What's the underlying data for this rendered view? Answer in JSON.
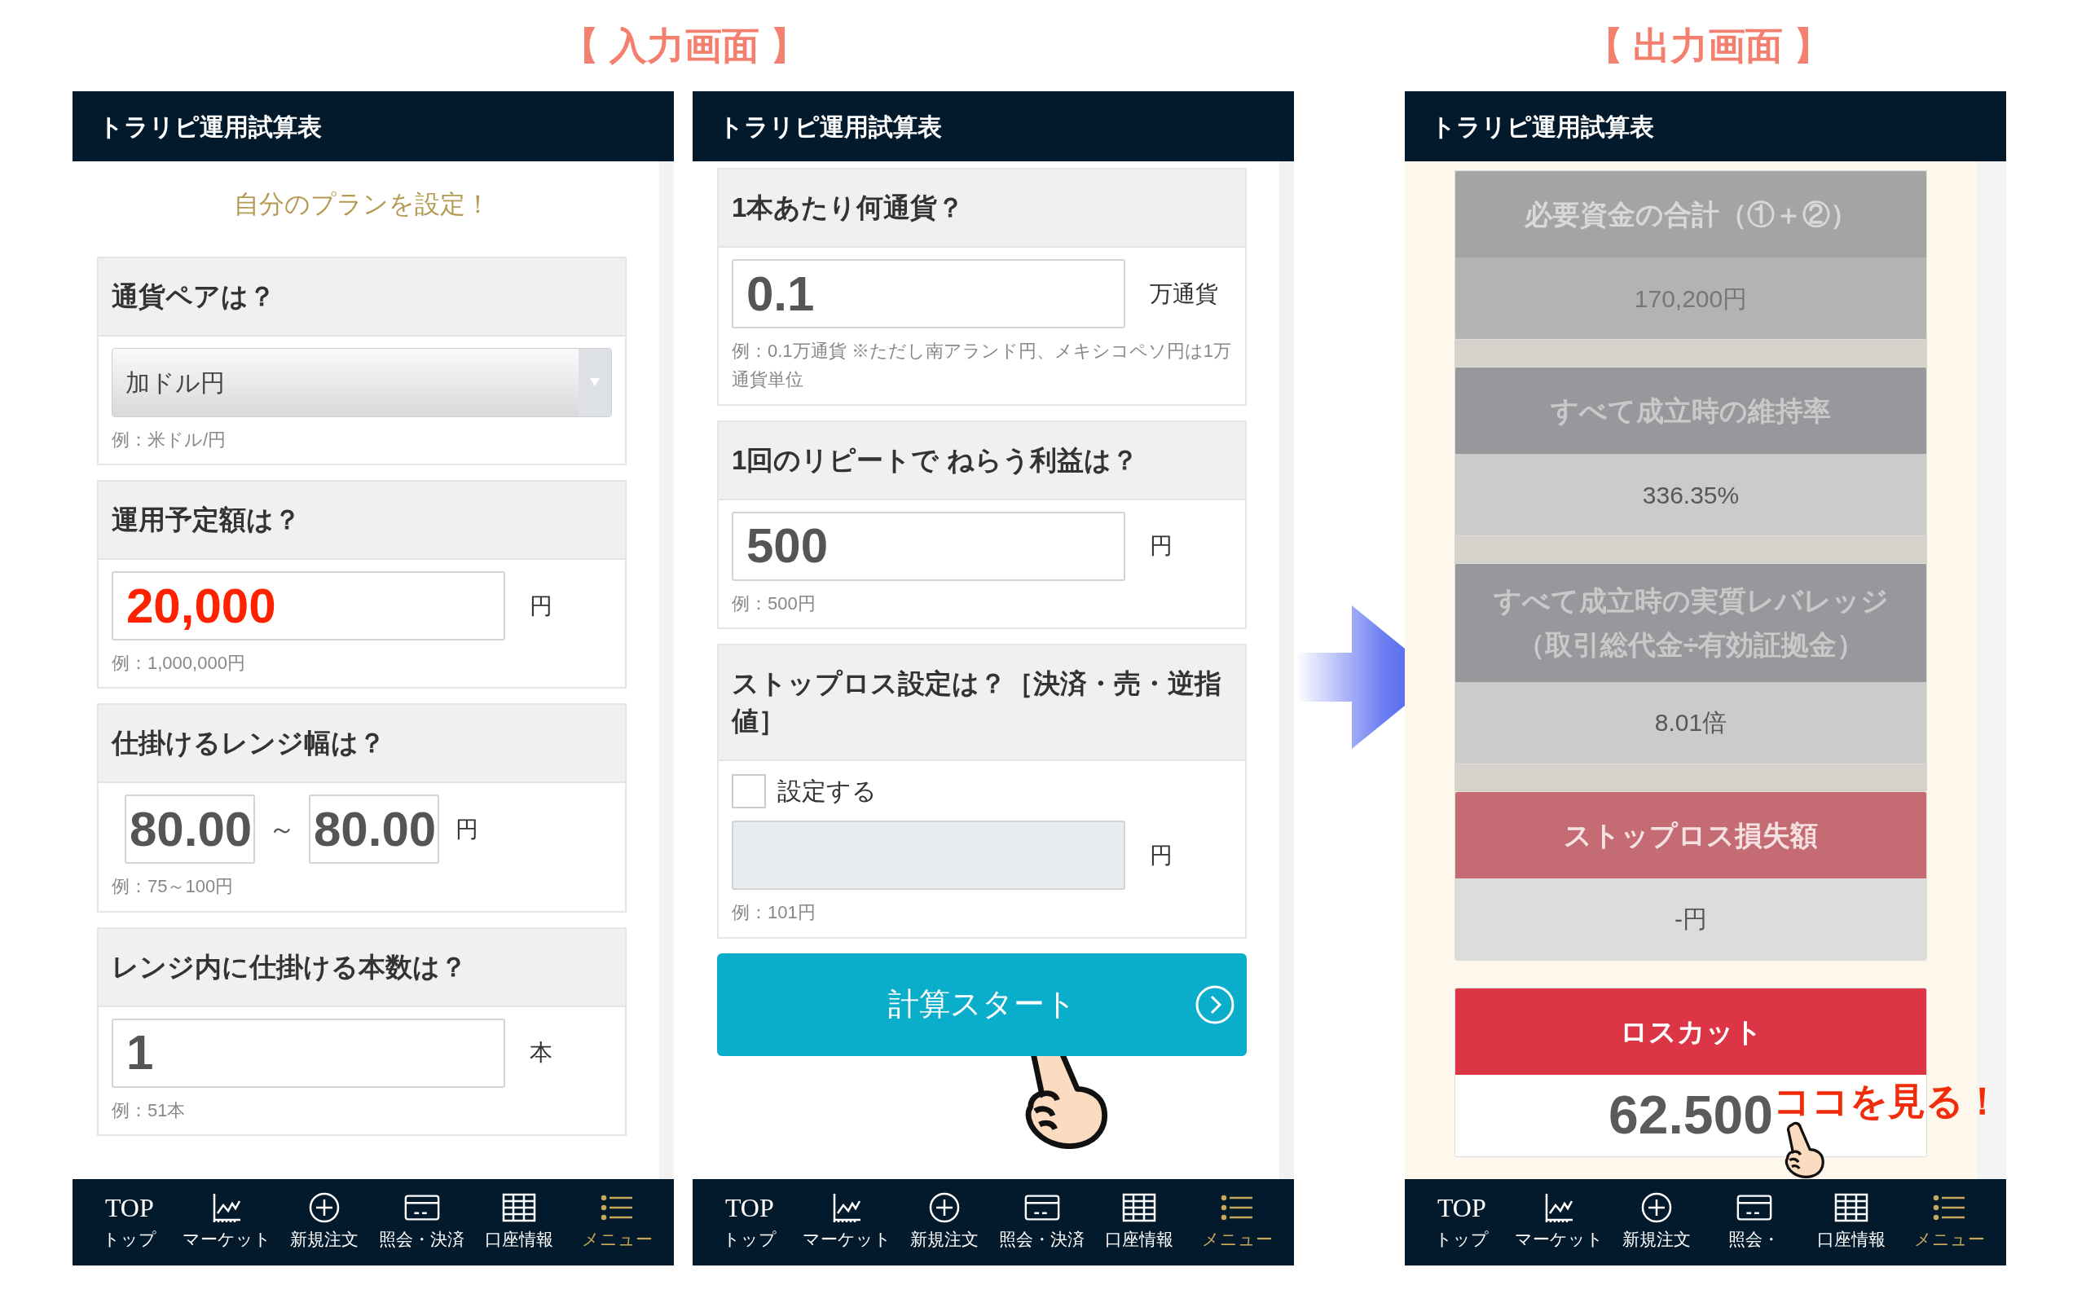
{
  "captions": [
    {
      "text": "【 入力画面 】"
    },
    {
      "text": "【 出力画面 】"
    }
  ],
  "screens": [
    {
      "kind": "input",
      "title": "トラリピ運用試算表",
      "intro": "自分のプランを設定！",
      "sections": [
        {
          "kind": "select",
          "heading": "通貨ペアは？",
          "value": "加ドル円",
          "hint": "例：米ドル/円"
        },
        {
          "kind": "input",
          "heading": "運用予定額は？",
          "value": "20,000",
          "highlighted": true,
          "unit": "円",
          "hint": "例：1,000,000円"
        },
        {
          "kind": "range",
          "heading": "仕掛けるレンジ幅は？",
          "values": [
            "80.00",
            "80.00"
          ],
          "separator": "～",
          "unit": "円",
          "hint": "例：75～100円"
        },
        {
          "kind": "input",
          "heading": "レンジ内に仕掛ける本数は？",
          "value": "1",
          "highlighted": false,
          "unit": "本",
          "hint": "例：51本"
        }
      ],
      "nav": [
        {
          "mark": "TOP",
          "label": "トップ",
          "selected": false
        },
        {
          "label": "マーケット",
          "selected": false
        },
        {
          "label": "新規注文",
          "selected": false
        },
        {
          "label": "照会・決済",
          "selected": false
        },
        {
          "label": "口座情報",
          "selected": false
        },
        {
          "label": "メニュー",
          "selected": true
        }
      ]
    },
    {
      "kind": "input",
      "title": "トラリピ運用試算表",
      "sections": [
        {
          "kind": "input",
          "heading": "1本あたり何通貨？",
          "value": "0.1",
          "highlighted": false,
          "unit": "万通貨",
          "hint": "例：0.1万通貨 ※ただし南アランド円、メキシコペソ円は1万通貨単位"
        },
        {
          "kind": "input",
          "heading": "1回のリピートで ねらう利益は？",
          "value": "500",
          "highlighted": false,
          "unit": "円",
          "hint": "例：500円"
        },
        {
          "kind": "checkbox_input",
          "heading": "ストップロス設定は？［決済・売・逆指値］",
          "checkbox_label": "設定する",
          "checked": false,
          "unit": "円",
          "hint": "例：101円"
        }
      ],
      "button": {
        "label": "計算スタート"
      },
      "nav": [
        {
          "mark": "TOP",
          "label": "トップ",
          "selected": false
        },
        {
          "label": "マーケット",
          "selected": false
        },
        {
          "label": "新規注文",
          "selected": false
        },
        {
          "label": "照会・決済",
          "selected": false
        },
        {
          "label": "口座情報",
          "selected": false
        },
        {
          "label": "メニュー",
          "selected": true
        }
      ]
    },
    {
      "kind": "output",
      "title": "トラリピ運用試算表",
      "results": [
        {
          "kind": "dim",
          "label": [
            "必要資金の合計（①＋②）"
          ],
          "value": "170,200円"
        },
        {
          "kind": "muted",
          "label": [
            "すべて成立時の維持率"
          ],
          "value": "336.35%"
        },
        {
          "kind": "muted",
          "label": [
            "すべて成立時の実質レバレッジ",
            "（取引総代金÷有効証拠金）"
          ],
          "value": "8.01倍"
        },
        {
          "kind": "muted_red",
          "label": [
            "ストップロス損失額"
          ],
          "value": "-円"
        },
        {
          "kind": "strong_red",
          "label": [
            "ロスカット"
          ],
          "value": "62.500"
        }
      ],
      "callout": "ココを見る！",
      "nav": [
        {
          "mark": "TOP",
          "label": "トップ",
          "selected": false
        },
        {
          "label": "マーケット",
          "selected": false
        },
        {
          "label": "新規注文",
          "selected": false
        },
        {
          "label": "照会・",
          "selected": false
        },
        {
          "label": "口座情報",
          "selected": false
        },
        {
          "label": "メニュー",
          "selected": true
        }
      ]
    }
  ]
}
